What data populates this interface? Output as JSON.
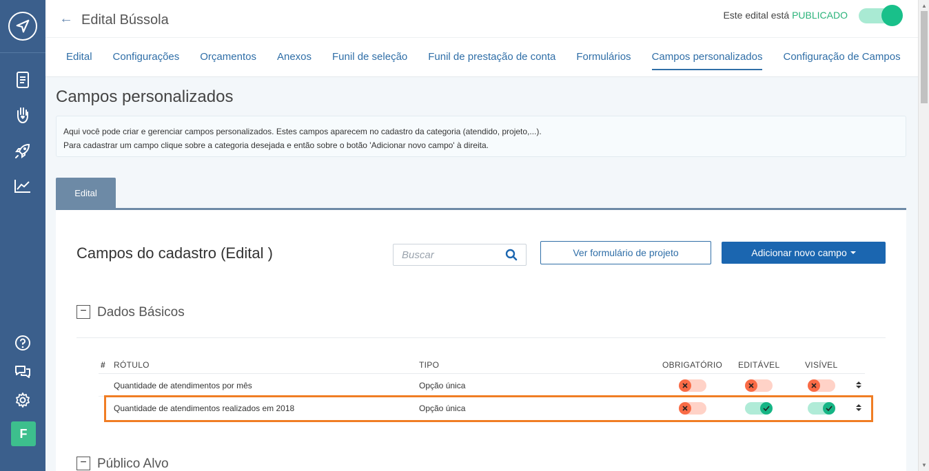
{
  "sidebar": {
    "avatar_letter": "F",
    "icons": [
      "compass-logo-icon",
      "document-icon",
      "hand-heart-icon",
      "rocket-icon",
      "chart-line-icon",
      "help-icon",
      "chat-icon",
      "gear-icon"
    ]
  },
  "header": {
    "title": "Edital Bússola",
    "status_prefix": "Este edital está",
    "status_value": "PUBLICADO",
    "published": true,
    "tabs": [
      {
        "label": "Edital"
      },
      {
        "label": "Configurações"
      },
      {
        "label": "Orçamentos"
      },
      {
        "label": "Anexos"
      },
      {
        "label": "Funil de seleção"
      },
      {
        "label": "Funil de prestação de conta"
      },
      {
        "label": "Formulários"
      },
      {
        "label": "Campos personalizados"
      },
      {
        "label": "Configuração de Campos"
      }
    ],
    "active_tab": "Campos personalizados"
  },
  "content": {
    "title": "Campos personalizados",
    "info_line1": "Aqui você pode criar e gerenciar campos personalizados. Estes campos aparecem no cadastro da categoria (atendido, projeto,...).",
    "info_line2": "Para cadastrar um campo clique sobre a categoria desejada e então sobre o botão 'Adicionar novo campo' à direita.",
    "category_tab": "Edital"
  },
  "panel": {
    "title": "Campos do cadastro (Edital )",
    "search_placeholder": "Buscar",
    "view_form_button": "Ver formulário de projeto",
    "add_field_button": "Adicionar novo campo",
    "groups": [
      {
        "title": "Dados Básicos",
        "toggle": "−"
      },
      {
        "title": "Público Alvo",
        "toggle": "−"
      }
    ],
    "columns": {
      "num": "#",
      "label": "RÓTULO",
      "type": "TIPO",
      "required": "OBRIGATÓRIO",
      "editable": "EDITÁVEL",
      "visible": "VISÍVEL"
    },
    "rows": [
      {
        "label": "Quantidade de atendimentos por mês",
        "type": "Opção única",
        "required": false,
        "editable": false,
        "visible": false
      },
      {
        "label": "Quantidade de atendimentos realizados em 2018",
        "type": "Opção única",
        "required": false,
        "editable": true,
        "visible": true
      }
    ]
  },
  "colors": {
    "sidebar": "#3b5f8c",
    "accent": "#2f6ea7",
    "primary_button": "#1b66b0",
    "success": "#16b585",
    "danger": "#f96b46",
    "highlight": "#f07d24"
  }
}
